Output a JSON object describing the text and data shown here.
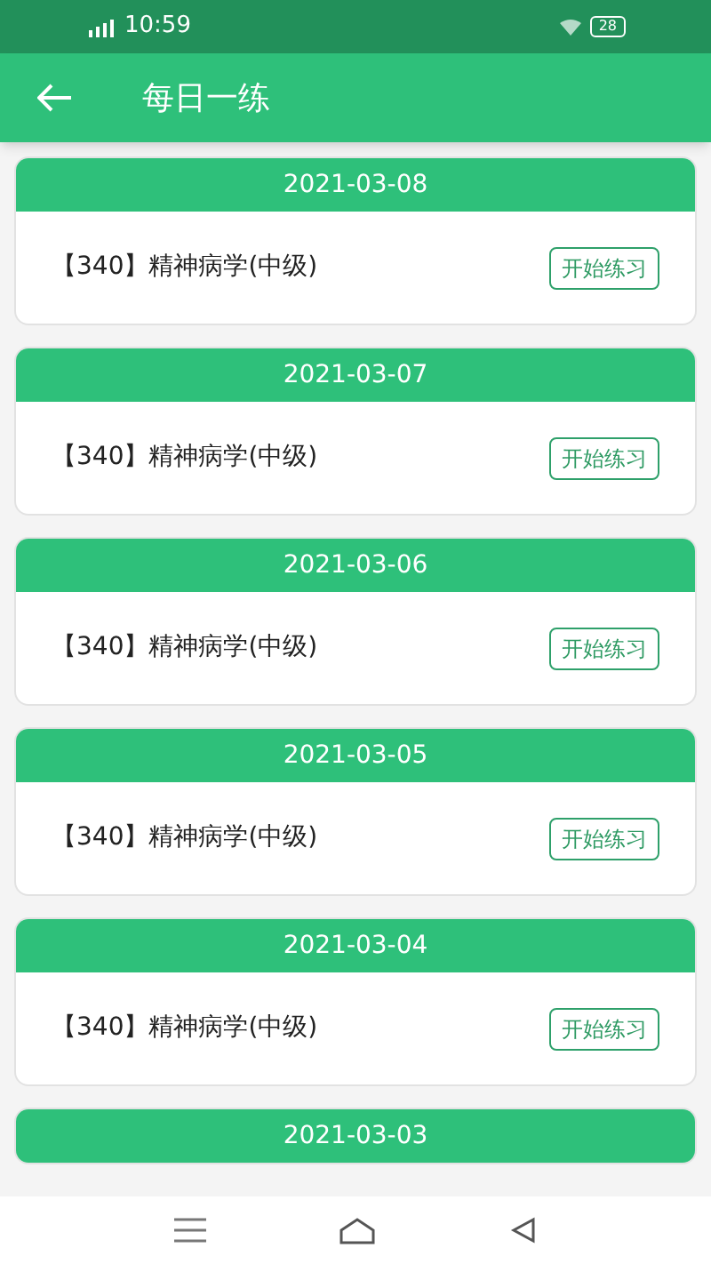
{
  "status_bar": {
    "time": "10:59",
    "battery": "28"
  },
  "app_bar": {
    "title": "每日一练"
  },
  "practices": [
    {
      "date": "2021-03-08",
      "subject": "【340】精神病学(中级)",
      "action": "开始练习"
    },
    {
      "date": "2021-03-07",
      "subject": "【340】精神病学(中级)",
      "action": "开始练习"
    },
    {
      "date": "2021-03-06",
      "subject": "【340】精神病学(中级)",
      "action": "开始练习"
    },
    {
      "date": "2021-03-05",
      "subject": "【340】精神病学(中级)",
      "action": "开始练习"
    },
    {
      "date": "2021-03-04",
      "subject": "【340】精神病学(中级)",
      "action": "开始练习"
    },
    {
      "date": "2021-03-03"
    }
  ]
}
